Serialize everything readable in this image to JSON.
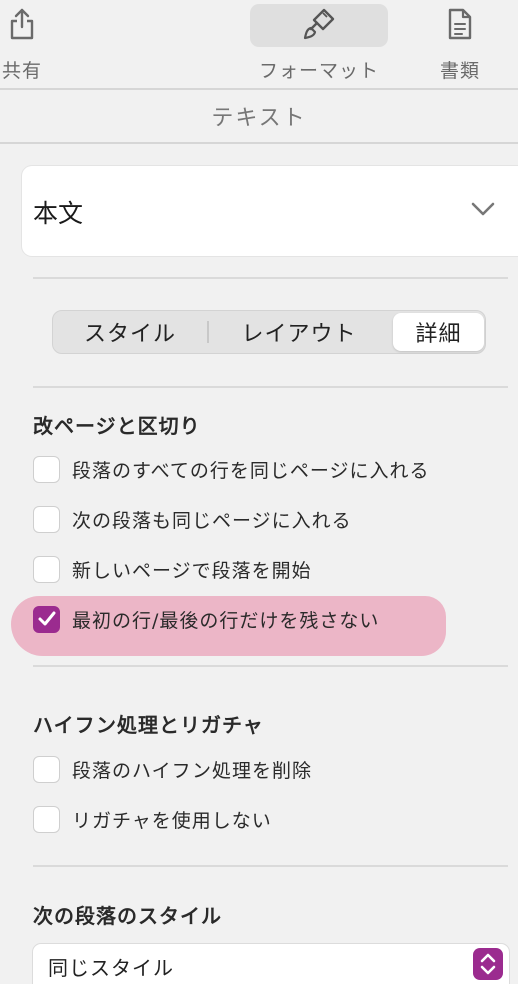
{
  "toolbar": {
    "share_label": "共有",
    "format_label": "フォーマット",
    "document_label": "書類"
  },
  "panel": {
    "title": "テキスト"
  },
  "paragraph_style": {
    "value": "本文"
  },
  "tabs": [
    {
      "label": "スタイル",
      "selected": false
    },
    {
      "label": "レイアウト",
      "selected": false
    },
    {
      "label": "詳細",
      "selected": true
    }
  ],
  "sections": {
    "page_breaks": {
      "title": "改ページと区切り",
      "options": [
        {
          "label": "段落のすべての行を同じページに入れる",
          "checked": false
        },
        {
          "label": "次の段落も同じページに入れる",
          "checked": false
        },
        {
          "label": "新しいページで段落を開始",
          "checked": false
        },
        {
          "label": "最初の行/最後の行だけを残さない",
          "checked": true
        }
      ]
    },
    "hyphenation": {
      "title": "ハイフン処理とリガチャ",
      "options": [
        {
          "label": "段落のハイフン処理を削除",
          "checked": false
        },
        {
          "label": "リガチャを使用しない",
          "checked": false
        }
      ]
    },
    "next_style": {
      "title": "次の段落のスタイル",
      "value": "同じスタイル"
    }
  },
  "colors": {
    "accent": "#9b2b8f",
    "highlight": "#ecb6c7"
  }
}
